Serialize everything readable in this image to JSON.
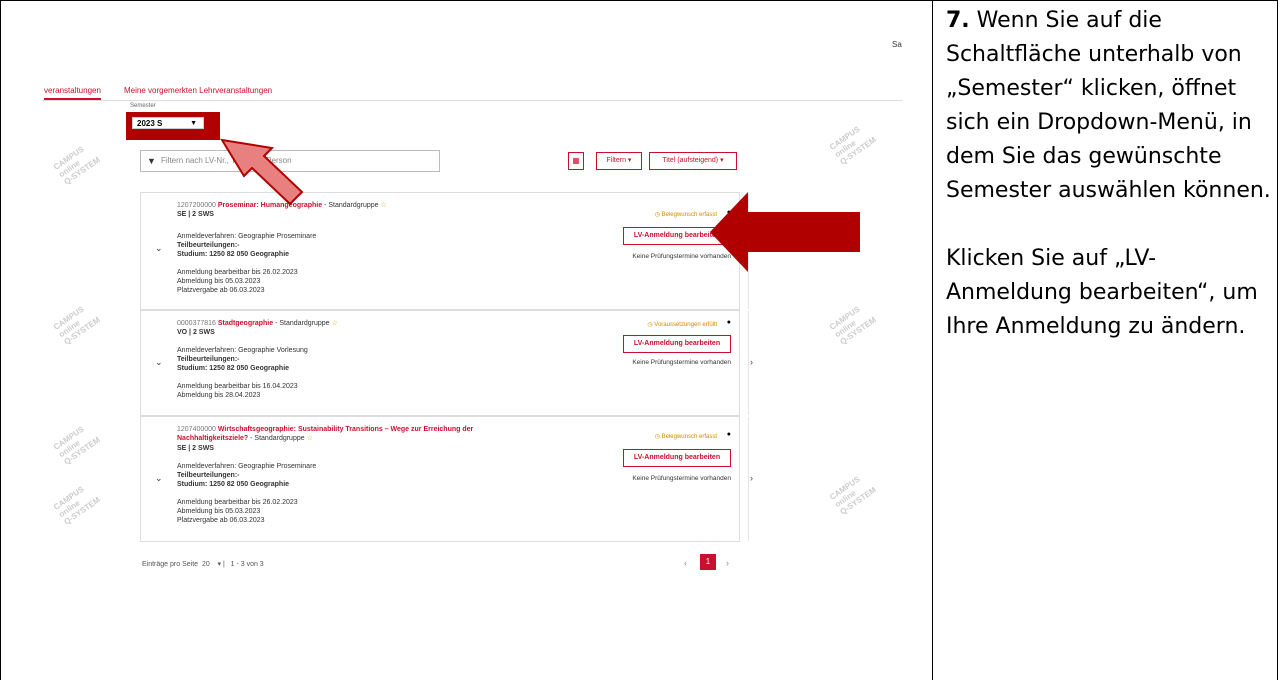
{
  "instructions": {
    "step_number": "7.",
    "para1": "Wenn Sie auf die Schaltfläche unterhalb von „Semester“ klicken, öffnet sich ein Dropdown-Menü, in dem Sie das gewünschte Semester auswählen können.",
    "para2": "Klicken Sie auf „LV-Anmeldung bearbeiten“, um Ihre Anmeldung zu ändern."
  },
  "screenshot": {
    "user_short": "Sa",
    "tabs": [
      "veranstaltungen",
      "Meine vorgemerkten Lehrveranstaltungen"
    ],
    "semester_label": "Semester",
    "semester_value": "2023 S",
    "filter_placeholder": "Filtern nach LV-Nr., Titel oder Person",
    "filter_button": "Filtern ▾",
    "sort_button": "Titel (aufsteigend) ▾",
    "courses": [
      {
        "number": "1207200000",
        "title": "Proseminar: Humangeographie",
        "group": " - Standardgruppe",
        "type": "SE | 2 SWS",
        "procedure": "Anmeldeverfahren: Geographie Proseminare",
        "assessments": "Teilbeurteilungen:-",
        "study": "Studium: 1250 82 050 Geographie",
        "dates": [
          "Anmeldung bearbeitbar bis 26.02.2023",
          "Abmeldung bis 05.03.2023",
          "Platzvergabe ab 06.03.2023"
        ],
        "status": "Belegwunsch erfasst",
        "button": "LV-Anmeldung bearbeiten",
        "exams": "Keine Prüfungstermine vorhanden"
      },
      {
        "number": "0000377816",
        "title": "Stadtgeographie",
        "group": " - Standardgruppe",
        "type": "VO | 2 SWS",
        "procedure": "Anmeldeverfahren: Geographie Vorlesung",
        "assessments": "Teilbeurteilungen:-",
        "study": "Studium: 1250 82 050 Geographie",
        "dates": [
          "Anmeldung bearbeitbar bis 16.04.2023",
          "Abmeldung bis 28.04.2023"
        ],
        "status": "Voraussetzungen erfüllt",
        "button": "LV-Anmeldung bearbeiten",
        "exams": "Keine Prüfungstermine vorhanden"
      },
      {
        "number": "1207400000",
        "title": "Wirtschaftsgeographie: Sustainability Transitions – Wege zur Erreichung der Nachhaltigkeitsziele?",
        "group": " - Standardgruppe",
        "type": "SE | 2 SWS",
        "procedure": "Anmeldeverfahren: Geographie Proseminare",
        "assessments": "Teilbeurteilungen:-",
        "study": "Studium: 1250 82 050 Geographie",
        "dates": [
          "Anmeldung bearbeitbar bis 26.02.2023",
          "Abmeldung bis 05.03.2023",
          "Platzvergabe ab 06.03.2023"
        ],
        "status": "Belegwunsch erfasst",
        "button": "LV-Anmeldung bearbeiten",
        "exams": "Keine Prüfungstermine vorhanden"
      }
    ],
    "pager": {
      "entries_label": "Einträge pro Seite",
      "entries_value": "20",
      "range": "1 - 3 von 3",
      "page": "1"
    },
    "watermark": [
      "CAMPUS",
      "online",
      "Q-SYSTEM"
    ]
  },
  "colors": {
    "accent": "#c8102e",
    "annotation_arrow": "#b00000",
    "annotation_arrow_light": "#e88080"
  }
}
